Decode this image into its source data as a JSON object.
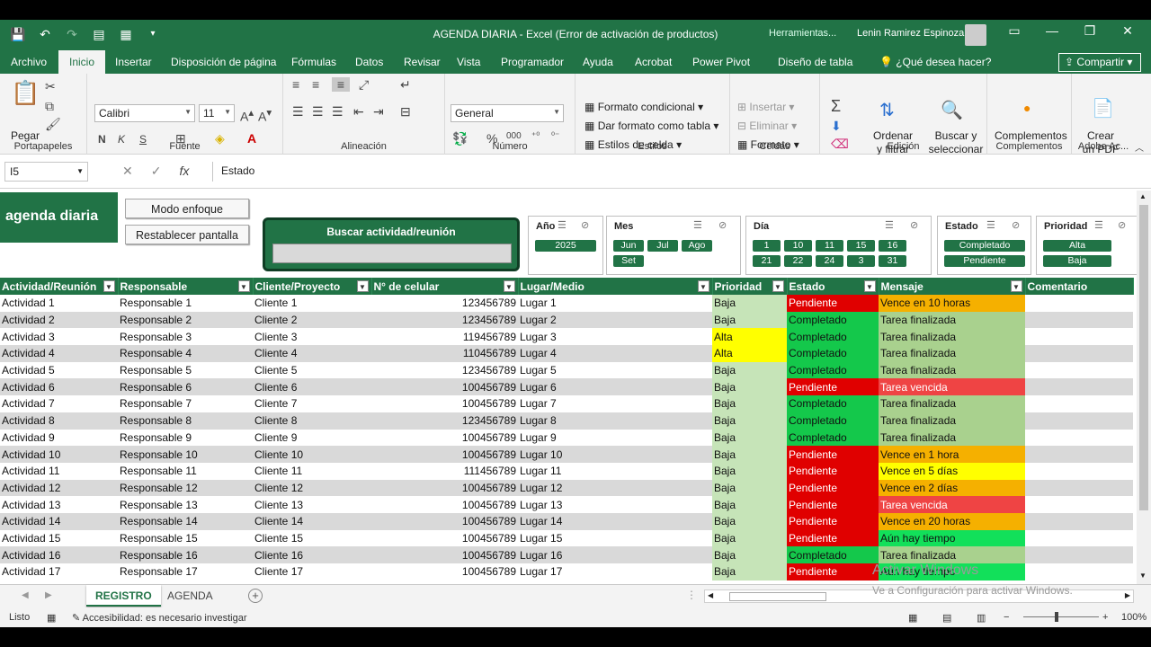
{
  "window": {
    "title": "AGENDA DIARIA  -  Excel (Error de activación de productos)",
    "herramientas": "Herramientas...",
    "user": "Lenin Ramirez Espinoza"
  },
  "tabs": [
    "Archivo",
    "Inicio",
    "Insertar",
    "Disposición de página",
    "Fórmulas",
    "Datos",
    "Revisar",
    "Vista",
    "Programador",
    "Ayuda",
    "Acrobat",
    "Power Pivot",
    "Diseño de tabla"
  ],
  "help": "¿Qué desea hacer?",
  "share": "Compartir",
  "ribbon": {
    "paste": "Pegar",
    "clipboard": "Portapapeles",
    "font_name": "Calibri",
    "font_size": "11",
    "font": "Fuente",
    "bold": "N",
    "italic": "K",
    "underline": "S",
    "alignment": "Alineación",
    "number_format": "General",
    "number": "Número",
    "cond_format": "Formato condicional",
    "table_format": "Dar formato como tabla",
    "cell_styles": "Estilos de celda",
    "styles": "Estilos",
    "insert": "Insertar",
    "delete": "Eliminar",
    "format": "Formato",
    "cells": "Celdas",
    "sort": "Ordenar y filtrar",
    "find": "Buscar y seleccionar",
    "editing": "Edición",
    "addins": "Complementos",
    "addins_group": "Complementos",
    "pdf": "Crear un PDF",
    "adobe": "Adobe Ac..."
  },
  "formula": {
    "namebox": "I5",
    "fx": "fx",
    "value": "Estado"
  },
  "sheet": {
    "logo": "agenda diaria",
    "btn_focus": "Modo enfoque",
    "btn_reset": "Restablecer pantalla",
    "search_label": "Buscar actividad/reunión"
  },
  "slicers": {
    "year": {
      "title": "Año",
      "items": [
        "2025"
      ]
    },
    "month": {
      "title": "Mes",
      "items": [
        "Jun",
        "Jul",
        "Ago",
        "Set"
      ]
    },
    "day": {
      "title": "Día",
      "items": [
        "1",
        "10",
        "11",
        "15",
        "16",
        "21",
        "22",
        "24",
        "3",
        "31"
      ]
    },
    "status": {
      "title": "Estado",
      "items": [
        "Completado",
        "Pendiente"
      ]
    },
    "priority": {
      "title": "Prioridad",
      "items": [
        "Alta",
        "Baja"
      ]
    }
  },
  "table": {
    "headers": [
      "Actividad/Reunión",
      "Responsable",
      "Cliente/Proyecto",
      "N° de celular",
      "Lugar/Medio",
      "Prioridad",
      "Estado",
      "Mensaje",
      "Comentario"
    ],
    "rows": [
      [
        "Actividad 1",
        "Responsable 1",
        "Cliente 1",
        "123456789",
        "Lugar 1",
        "Baja",
        "Pendiente",
        "Vence en 10 horas",
        ""
      ],
      [
        "Actividad 2",
        "Responsable 2",
        "Cliente 2",
        "123456789",
        "Lugar 2",
        "Baja",
        "Completado",
        "Tarea finalizada",
        ""
      ],
      [
        "Actividad 3",
        "Responsable 3",
        "Cliente 3",
        "119456789",
        "Lugar 3",
        "Alta",
        "Completado",
        "Tarea finalizada",
        ""
      ],
      [
        "Actividad 4",
        "Responsable 4",
        "Cliente 4",
        "110456789",
        "Lugar 4",
        "Alta",
        "Completado",
        "Tarea finalizada",
        ""
      ],
      [
        "Actividad 5",
        "Responsable 5",
        "Cliente 5",
        "123456789",
        "Lugar 5",
        "Baja",
        "Completado",
        "Tarea finalizada",
        ""
      ],
      [
        "Actividad 6",
        "Responsable 6",
        "Cliente 6",
        "100456789",
        "Lugar 6",
        "Baja",
        "Pendiente",
        "Tarea vencida",
        ""
      ],
      [
        "Actividad 7",
        "Responsable 7",
        "Cliente 7",
        "100456789",
        "Lugar 7",
        "Baja",
        "Completado",
        "Tarea finalizada",
        ""
      ],
      [
        "Actividad 8",
        "Responsable 8",
        "Cliente 8",
        "123456789",
        "Lugar 8",
        "Baja",
        "Completado",
        "Tarea finalizada",
        ""
      ],
      [
        "Actividad 9",
        "Responsable 9",
        "Cliente 9",
        "100456789",
        "Lugar 9",
        "Baja",
        "Completado",
        "Tarea finalizada",
        ""
      ],
      [
        "Actividad 10",
        "Responsable 10",
        "Cliente 10",
        "100456789",
        "Lugar 10",
        "Baja",
        "Pendiente",
        "Vence en 1 hora",
        ""
      ],
      [
        "Actividad 11",
        "Responsable 11",
        "Cliente 11",
        "111456789",
        "Lugar 11",
        "Baja",
        "Pendiente",
        "Vence en 5 días",
        ""
      ],
      [
        "Actividad 12",
        "Responsable 12",
        "Cliente 12",
        "100456789",
        "Lugar 12",
        "Baja",
        "Pendiente",
        "Vence en 2 días",
        ""
      ],
      [
        "Actividad 13",
        "Responsable 13",
        "Cliente 13",
        "100456789",
        "Lugar 13",
        "Baja",
        "Pendiente",
        "Tarea vencida",
        ""
      ],
      [
        "Actividad 14",
        "Responsable 14",
        "Cliente 14",
        "100456789",
        "Lugar 14",
        "Baja",
        "Pendiente",
        "Vence en 20 horas",
        ""
      ],
      [
        "Actividad 15",
        "Responsable 15",
        "Cliente 15",
        "100456789",
        "Lugar 15",
        "Baja",
        "Pendiente",
        "Aún hay tiempo",
        ""
      ],
      [
        "Actividad 16",
        "Responsable 16",
        "Cliente 16",
        "100456789",
        "Lugar 16",
        "Baja",
        "Completado",
        "Tarea finalizada",
        ""
      ],
      [
        "Actividad 17",
        "Responsable 17",
        "Cliente 17",
        "100456789",
        "Lugar 17",
        "Baja",
        "Pendiente",
        "Aún hay tiempo",
        ""
      ]
    ],
    "msg_classes": [
      "hora",
      "fin",
      "fin",
      "fin",
      "fin",
      "venc",
      "fin",
      "fin",
      "fin",
      "hora",
      "dias",
      "dias2",
      "venc",
      "hora",
      "tiempo",
      "fin",
      "tiempo"
    ]
  },
  "sheet_tabs": [
    "REGISTRO",
    "AGENDA"
  ],
  "watermark": {
    "line1": "Activar Windows",
    "line2": "Ve a Configuración para activar Windows."
  },
  "status": {
    "ready": "Listo",
    "accessibility": "Accesibilidad: es necesario investigar",
    "zoom": "100%"
  },
  "colors": {
    "brand": "#217346",
    "pending": "#e00000",
    "done": "#14c84b",
    "high": "#ffff00"
  }
}
